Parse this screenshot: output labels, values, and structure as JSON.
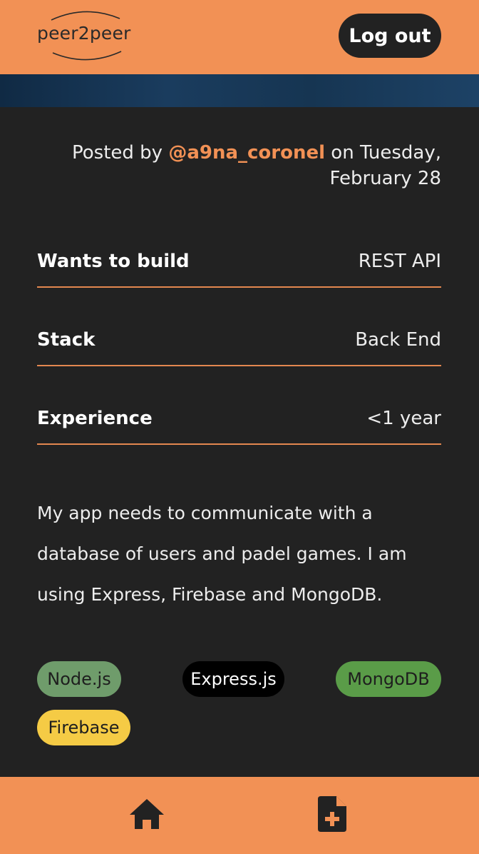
{
  "header": {
    "logo_text": "peer2peer",
    "logout_label": "Log out"
  },
  "post": {
    "posted_prefix": "Posted by ",
    "username": "@a9na_coronel",
    "posted_suffix": " on Tuesday, February 28",
    "rows": [
      {
        "label": "Wants to build",
        "value": "REST API"
      },
      {
        "label": "Stack",
        "value": "Back End"
      },
      {
        "label": "Experience",
        "value": "<1 year"
      }
    ],
    "description": "My app needs to communicate with a database of users and padel games. I am using Express, Firebase and MongoDB.",
    "tags": [
      {
        "label": "Node.js",
        "bg": "#6F9C6B",
        "color": "#1E1E1E"
      },
      {
        "label": "Express.js",
        "bg": "#000000",
        "color": "#FFFFFF"
      },
      {
        "label": "MongoDB",
        "bg": "#5A9C48",
        "color": "#1E1E1E"
      },
      {
        "label": "Firebase",
        "bg": "#F5CB45",
        "color": "#1E1E1E"
      }
    ]
  },
  "bottom_nav": {
    "items": [
      {
        "icon": "home-icon"
      },
      {
        "icon": "new-post-icon"
      }
    ]
  },
  "colors": {
    "accent": "#F29155",
    "background": "#222222",
    "divider": "#E3874F"
  }
}
